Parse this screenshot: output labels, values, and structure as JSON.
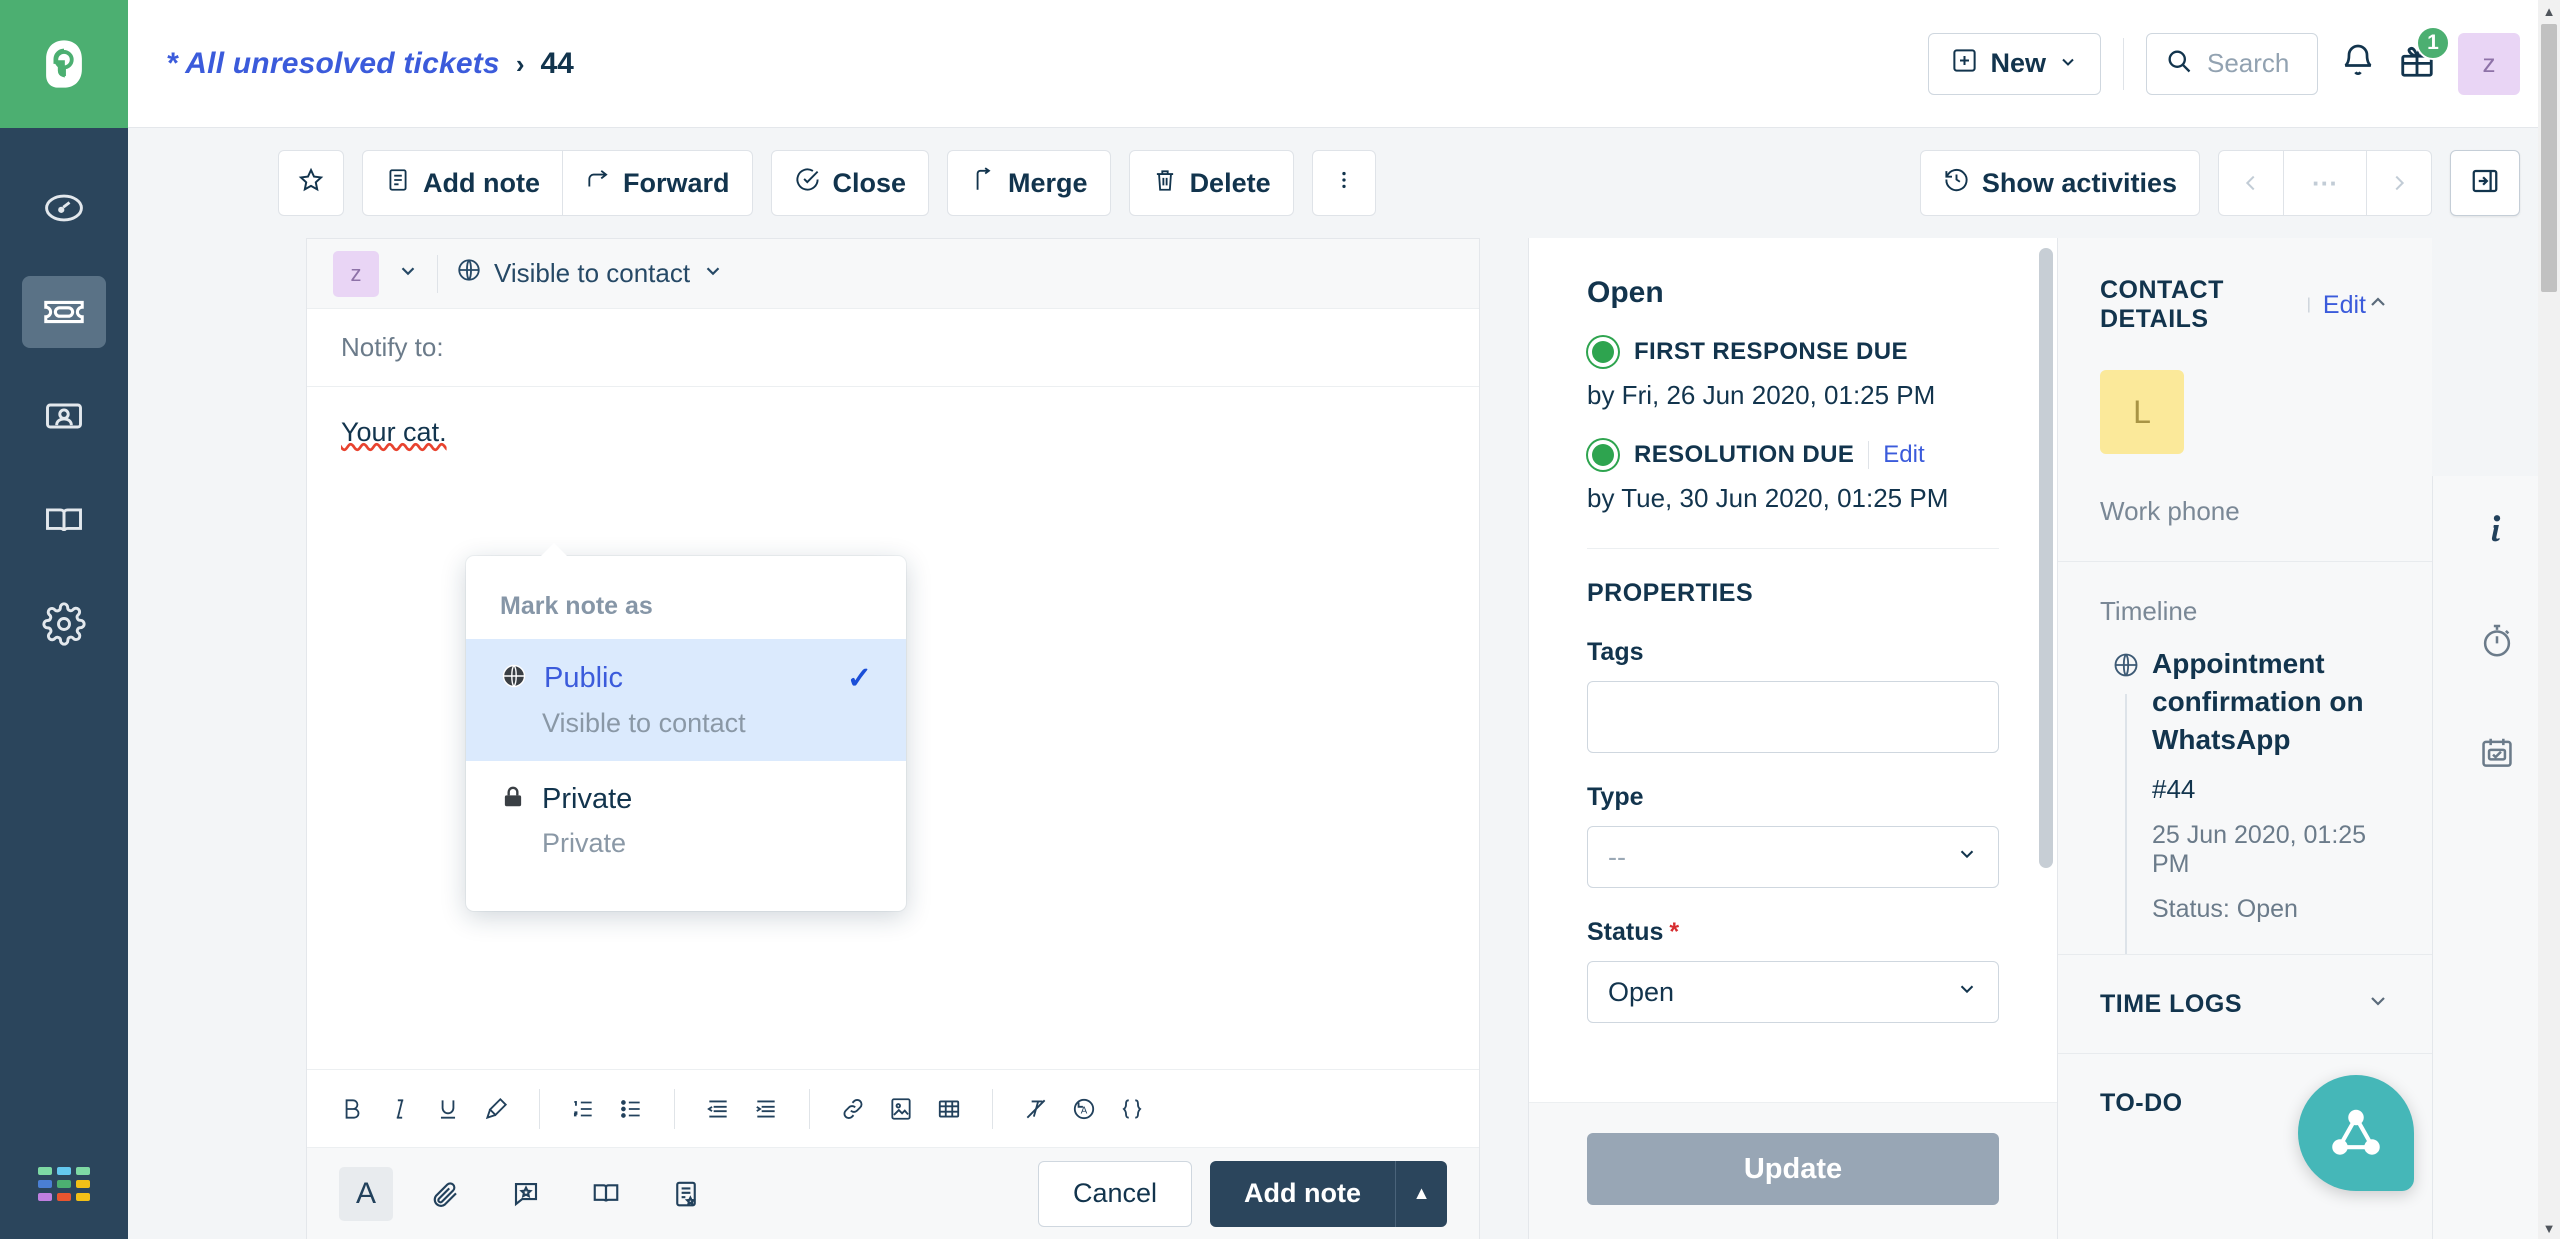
{
  "header": {
    "breadcrumb_link": "* All unresolved tickets",
    "breadcrumb_separator": "›",
    "breadcrumb_current": "44",
    "new_button": "New",
    "search_placeholder": "Search",
    "gift_badge": "1",
    "avatar_initial": "z"
  },
  "toolbar": {
    "add_note": "Add note",
    "forward": "Forward",
    "close": "Close",
    "merge": "Merge",
    "delete": "Delete",
    "show_activities": "Show activities",
    "pager_ellipsis": "···"
  },
  "composer": {
    "avatar_initial": "z",
    "visibility": "Visible to contact",
    "notify_label": "Notify to:",
    "body_text": "Your cat.",
    "cancel": "Cancel",
    "add_note": "Add note",
    "format_letter": "A"
  },
  "popup": {
    "title": "Mark note as",
    "options": [
      {
        "label": "Public",
        "sub": "Visible to contact",
        "icon": "globe-icon",
        "selected": true
      },
      {
        "label": "Private",
        "sub": "Private",
        "icon": "lock-icon",
        "selected": false
      }
    ],
    "check_glyph": "✓",
    "selected_color": "#3b5bdb",
    "selected_bg": "#dbeafd"
  },
  "properties": {
    "status_heading": "Open",
    "sla": [
      {
        "label": "FIRST RESPONSE DUE",
        "date": "by Fri, 26 Jun 2020, 01:25 PM",
        "edit": "",
        "dot_color": "#2ea44f"
      },
      {
        "label": "RESOLUTION DUE",
        "date": "by Tue, 30 Jun 2020, 01:25 PM",
        "edit": "Edit",
        "dot_color": "#2ea44f"
      }
    ],
    "section_title": "PROPERTIES",
    "fields": [
      {
        "label": "Tags",
        "value": "",
        "required": false,
        "type": "textarea"
      },
      {
        "label": "Type",
        "value": "--",
        "required": false,
        "type": "select"
      },
      {
        "label": "Status",
        "value": "Open",
        "required": true,
        "type": "select"
      }
    ],
    "required_mark": "*",
    "update_button": "Update"
  },
  "contact": {
    "title": "CONTACT DETAILS",
    "edit": "Edit",
    "avatar_initial": "L",
    "work_phone_label": "Work phone",
    "timeline_label": "Timeline",
    "timeline": [
      {
        "subject": "Appointment confirmation on WhatsApp",
        "ticket_id": "#44",
        "timestamp": "25 Jun 2020, 01:25 PM",
        "status": "Status: Open"
      }
    ],
    "sections": [
      {
        "label": "TIME LOGS"
      },
      {
        "label": "TO-DO"
      }
    ]
  },
  "sidebar": {
    "items": [
      {
        "name": "dashboard",
        "active": false
      },
      {
        "name": "tickets",
        "active": true
      },
      {
        "name": "contacts",
        "active": false
      },
      {
        "name": "solutions",
        "active": false
      },
      {
        "name": "admin",
        "active": false
      }
    ],
    "app_grid_colors": [
      "#7ed9a4",
      "#64c8ef",
      "#7ed9a4",
      "#4a7fd4",
      "#4caf71",
      "#f2c017",
      "#c07fe0",
      "#e8552f",
      "#f2c017"
    ]
  },
  "colors": {
    "brand_green": "#4caf71",
    "nav_dark": "#2b455c",
    "link_blue": "#3b5bdb",
    "fab_teal": "#45b7b8",
    "avatar_purple": "#e9d5f5",
    "avatar_yellow": "#fbe99a"
  }
}
